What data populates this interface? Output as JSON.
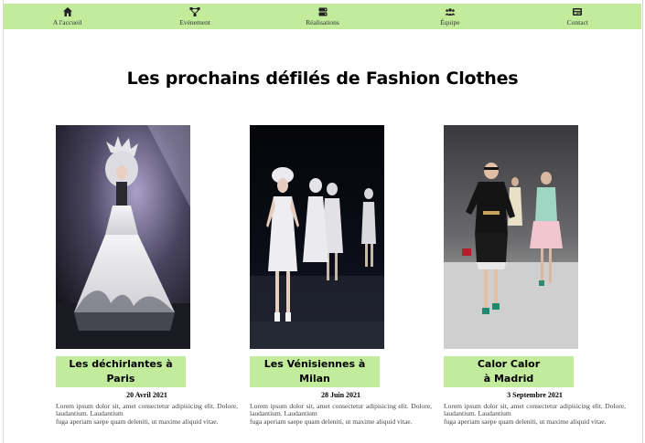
{
  "nav": {
    "items": [
      {
        "label": "A l'accueil",
        "icon": "home-icon"
      },
      {
        "label": "Evénement",
        "icon": "network-icon"
      },
      {
        "label": "Réalisations",
        "icon": "server-icon"
      },
      {
        "label": "Équipe",
        "icon": "users-icon"
      },
      {
        "label": "Contact",
        "icon": "contact-card-icon"
      }
    ]
  },
  "page": {
    "title": "Les prochains défilés de Fashion Clothes"
  },
  "cards": [
    {
      "title_line1": "Les déchirlantes à",
      "title_line2": "Paris",
      "date": "20 Avril 2021",
      "desc_line1": "Lorem ipsum dolor sit, amet consectetur adipisicing elit. Dolore, laudantium. Laudantium",
      "desc_line2": "fuga aperiam saepe quam deleniti, ut maxime aliquid vitae."
    },
    {
      "title_line1": "Les Vénisiennes à",
      "title_line2": "Milan",
      "date": "28 Juin 2021",
      "desc_line1": "Lorem ipsum dolor sit, amet consectetur adipisicing elit. Dolore, laudantium. Laudantium",
      "desc_line2": "fuga aperiam saepe quam deleniti, ut maxime aliquid vitae."
    },
    {
      "title_line1": "Calor Calor",
      "title_line2": "à Madrid",
      "date": "3 Septembre 2021",
      "desc_line1": "Lorem ipsum dolor sit, amet consectetur adipisicing elit. Dolore, laudantium. Laudantium",
      "desc_line2": "fuga aperiam saepe quam deleniti, ut maxime aliquid vitae."
    }
  ],
  "colors": {
    "nav_bg": "#c2ec9c",
    "title_box_bg": "#c2ec9c"
  }
}
